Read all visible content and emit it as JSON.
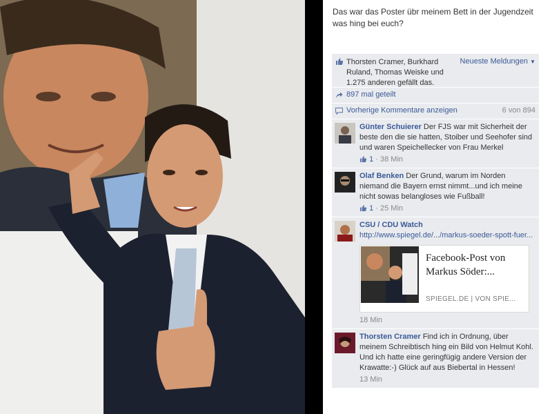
{
  "post": {
    "caption": "Das war das Poster übr meinem Bett in der Jugendzeit was hing bei euch?"
  },
  "ufi": {
    "likes_text": "Thorsten Cramer, Burkhard Ruland, Thomas Weiske und 1.275 anderen gefällt das.",
    "sort_label": "Neueste Meldungen",
    "sort_icon": "chevron-down-icon",
    "shares_text": "897 mal geteilt",
    "prev_comments_label": "Vorherige Kommentare anzeigen",
    "prev_comments_count": "6 von 894"
  },
  "comments": [
    {
      "author": "Günter Schuierer",
      "text": "Der FJS war mit Sicherheit der beste den die sie hatten, Stoiber und Seehofer sind und waren Speichellecker von Frau Merkel",
      "likes": "1",
      "time": "38 Min"
    },
    {
      "author": "Olaf Benken",
      "text": "Der Grund, warum im Norden niemand die Bayern ernst nimmt...und ich meine nicht sowas belangloses wie Fußball!",
      "likes": "1",
      "time": "25 Min"
    },
    {
      "author": "CSU / CDU Watch",
      "link": "http://www.spiegel.de/.../markus-soeder-spott-fuer...",
      "preview_title": "Facebook-Post von Markus Söder:...",
      "preview_domain": "SPIEGEL.DE | VON SPIE...",
      "time": "18 Min"
    },
    {
      "author": "Thorsten Cramer",
      "text": "Find ich in Ordnung, über meinem Schreibtisch hing ein Bild von Helmut Kohl. Und ich hatte eine geringfügig andere Version der Krawatte:-) Glück auf aus Biebertal in Hessen!",
      "time": "13 Min"
    }
  ],
  "colors": {
    "link": "#3b5998",
    "ufi_background": "#e9ebee",
    "muted": "#888888"
  }
}
